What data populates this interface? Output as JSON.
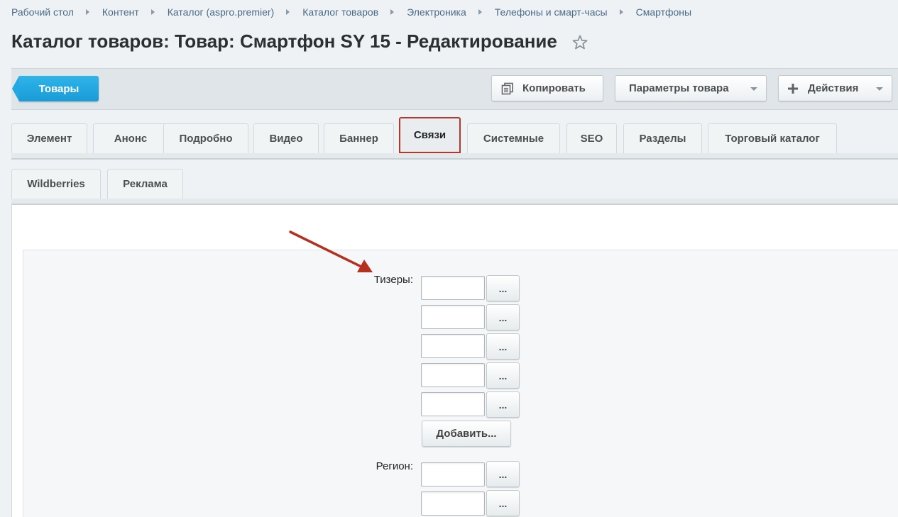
{
  "breadcrumb": [
    "Рабочий стол",
    "Контент",
    "Каталог (aspro.premier)",
    "Каталог товаров",
    "Электроника",
    "Телефоны и смарт-часы",
    "Смартфоны"
  ],
  "page": {
    "title": "Каталог товаров: Товар: Смартфон SY 15 - Редактирование",
    "favorite_icon": "star-icon"
  },
  "toolbar": {
    "back_label": "Товары",
    "copy_label": "Копировать",
    "copy_icon": "copy-icon",
    "params_label": "Параметры товара",
    "actions_label": "Действия",
    "actions_icon": "plus-icon"
  },
  "tabs": [
    {
      "label": "Элемент",
      "active": false
    },
    {
      "label": "Анонс",
      "active": false
    },
    {
      "label": "Подробно",
      "active": false
    },
    {
      "label": "Видео",
      "active": false
    },
    {
      "label": "Баннер",
      "active": false
    },
    {
      "label": "Связи",
      "active": true
    },
    {
      "label": "Системные",
      "active": false
    },
    {
      "label": "SEO",
      "active": false
    },
    {
      "label": "Разделы",
      "active": false
    },
    {
      "label": "Торговый каталог",
      "active": false
    }
  ],
  "subtabs": [
    {
      "label": "Wildberries"
    },
    {
      "label": "Реклама"
    }
  ],
  "form": {
    "teasers_label": "Тизеры:",
    "region_label": "Регион:",
    "pick_label": "...",
    "add_label": "Добавить...",
    "teaser_values": [
      "",
      "",
      "",
      "",
      ""
    ],
    "region_values": [
      "",
      ""
    ]
  },
  "colors": {
    "accent_blue": "#1fa4e0",
    "active_tab_border": "#b5362a",
    "annotation_arrow": "#b5301f"
  }
}
